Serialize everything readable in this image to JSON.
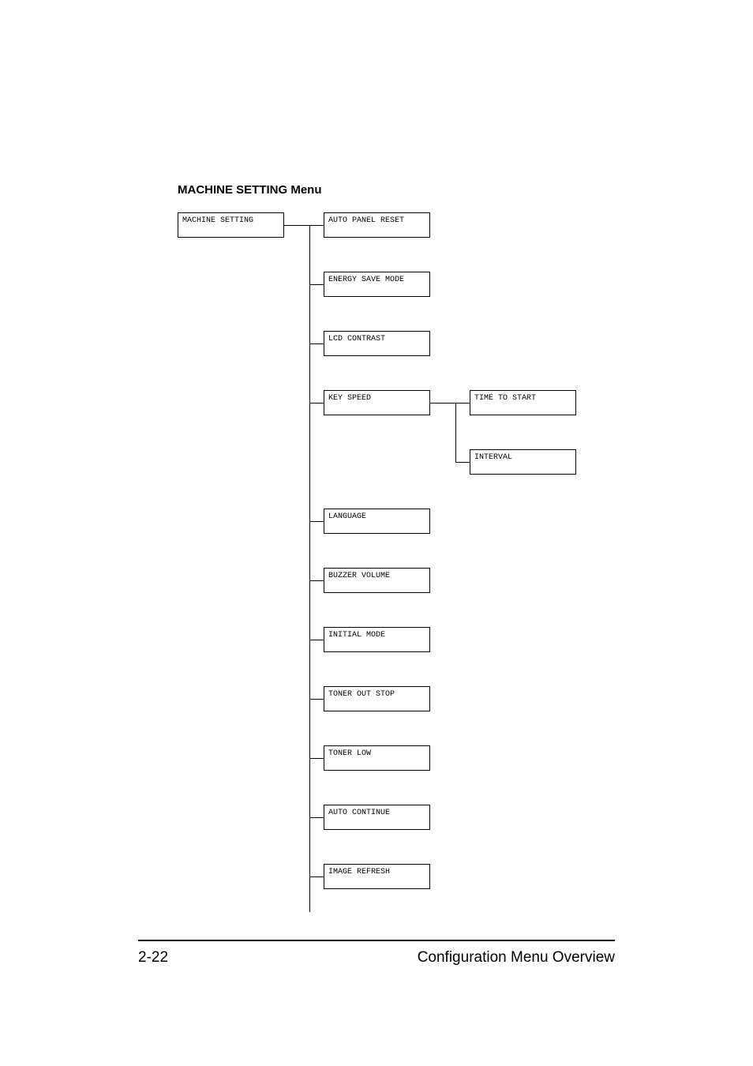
{
  "section_title": "MACHINE SETTING Menu",
  "root": "MACHINE SETTING",
  "level2": [
    "AUTO PANEL RESET",
    "ENERGY SAVE MODE",
    "LCD CONTRAST",
    "KEY SPEED",
    "LANGUAGE",
    "BUZZER VOLUME",
    "INITIAL MODE",
    "TONER OUT STOP",
    "TONER LOW",
    "AUTO CONTINUE",
    "IMAGE REFRESH"
  ],
  "key_speed_children": [
    "TIME TO START",
    "INTERVAL"
  ],
  "footer": {
    "page": "2-22",
    "title": "Configuration Menu Overview"
  }
}
